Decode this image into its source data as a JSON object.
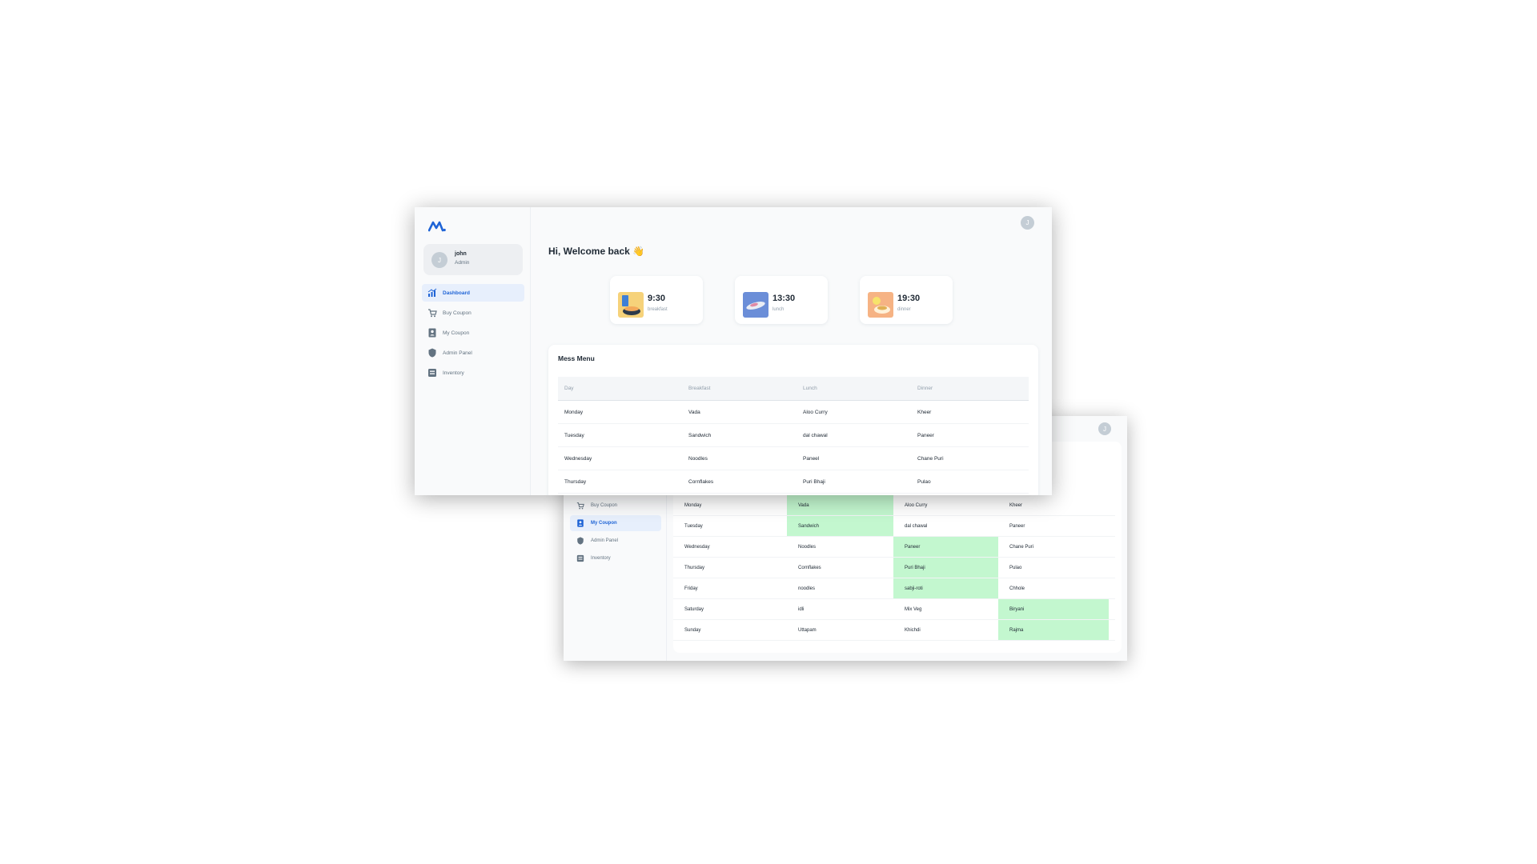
{
  "front": {
    "account": {
      "name": "john",
      "role": "Admin",
      "avatar_initial": "J"
    },
    "nav": [
      {
        "label": "Dashboard",
        "icon": "chart-icon",
        "active": true
      },
      {
        "label": "Buy Coupon",
        "icon": "cart-icon",
        "active": false
      },
      {
        "label": "My Coupon",
        "icon": "user-badge-icon",
        "active": false
      },
      {
        "label": "Admin Panel",
        "icon": "shield-icon",
        "active": false
      },
      {
        "label": "Inventory",
        "icon": "inventory-icon",
        "active": false
      }
    ],
    "topbar_avatar": "J",
    "welcome": "Hi, Welcome back 👋",
    "meals": [
      {
        "time": "9:30",
        "label": "breakfast",
        "icon": "breakfast-image"
      },
      {
        "time": "13:30",
        "label": "lunch",
        "icon": "lunch-image"
      },
      {
        "time": "19:30",
        "label": "dinner",
        "icon": "dinner-image"
      }
    ],
    "menu": {
      "title": "Mess Menu",
      "columns": [
        "Day",
        "Breakfast",
        "Lunch",
        "Dinner"
      ],
      "rows": [
        [
          "Monday",
          "Vada",
          "Aloo Curry",
          "Kheer"
        ],
        [
          "Tuesday",
          "Sandwich",
          "dal chawal",
          "Paneer"
        ],
        [
          "Wednesday",
          "Noodles",
          "Paneel",
          "Chane Puri"
        ],
        [
          "Thursday",
          "Cornflakes",
          "Puri Bhaji",
          "Pulao"
        ]
      ]
    }
  },
  "back": {
    "topbar_avatar": "J",
    "nav": [
      {
        "label": "Buy Coupon",
        "icon": "cart-icon",
        "active": false
      },
      {
        "label": "My Coupon",
        "icon": "user-badge-icon",
        "active": true
      },
      {
        "label": "Admin Panel",
        "icon": "shield-icon",
        "active": false
      },
      {
        "label": "Inventory",
        "icon": "inventory-icon",
        "active": false
      }
    ],
    "highlight_color": "#c3f7cf",
    "rows": [
      {
        "cells": [
          "Monday",
          "Vada",
          "Aloo Curry",
          "Kheer"
        ],
        "highlight": 1
      },
      {
        "cells": [
          "Tuesday",
          "Sandwich",
          "dal chawal",
          "Paneer"
        ],
        "highlight": 1
      },
      {
        "cells": [
          "Wednesday",
          "Noodles",
          "Paneer",
          "Chane Puri"
        ],
        "highlight": 2
      },
      {
        "cells": [
          "Thursday",
          "Cornflakes",
          "Puri Bhaji",
          "Pulao"
        ],
        "highlight": 2
      },
      {
        "cells": [
          "Friday",
          "noodles",
          "sabji-roti",
          "Chhole"
        ],
        "highlight": 2
      },
      {
        "cells": [
          "Saturday",
          "idli",
          "Mix Veg",
          "Biryani"
        ],
        "highlight": 3
      },
      {
        "cells": [
          "Sunday",
          "Uttapam",
          "Khichdi",
          "Rajma"
        ],
        "highlight": 3
      }
    ]
  }
}
